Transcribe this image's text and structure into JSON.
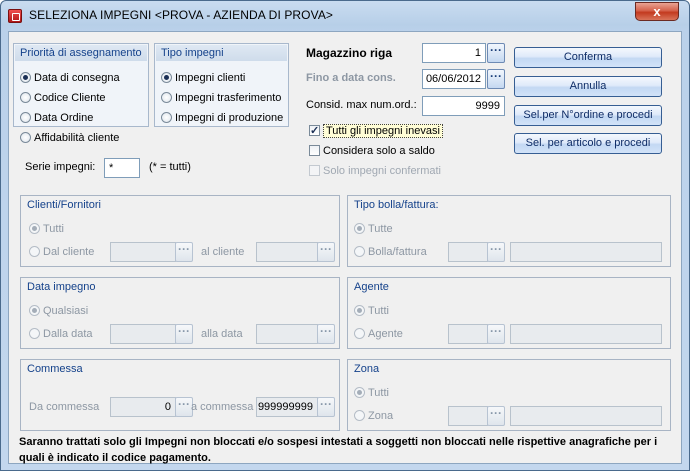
{
  "window": {
    "title": "SELEZIONA IMPEGNI <PROVA - AZIENDA DI PROVA>",
    "close_glyph": "x"
  },
  "priority": {
    "title": "Priorità di assegnamento",
    "options": [
      "Data di consegna",
      "Codice Cliente",
      "Data Ordine",
      "Affidabilità cliente"
    ],
    "selected": "Data di consegna"
  },
  "tipo_impegni": {
    "title": "Tipo impegni",
    "options": [
      "Impegni clienti",
      "Impegni trasferimento",
      "Impegni di produzione"
    ],
    "selected": "Impegni clienti"
  },
  "serie": {
    "label": "Serie impegni:",
    "value": "*",
    "hint": "(* = tutti)"
  },
  "magazzino": {
    "label": "Magazzino riga",
    "value": "1"
  },
  "fino_data": {
    "label": "Fino a data cons.",
    "value": "06/06/2012"
  },
  "consid": {
    "label": "Consid. max num.ord.:",
    "value": "9999"
  },
  "checks": {
    "tutti_inevasi": {
      "label": "Tutti gli impegni inevasi",
      "checked": true
    },
    "solo_saldo": {
      "label": "Considera solo a saldo",
      "checked": false
    },
    "solo_confermati": {
      "label": "Solo impegni confermati",
      "checked": false
    }
  },
  "buttons": {
    "conferma": "Conferma",
    "annulla": "Annulla",
    "sel_ordine": "Sel.per N°ordine e procedi",
    "sel_articolo": "Sel. per articolo e procedi"
  },
  "dots_glyph": "···",
  "clienti": {
    "title": "Clienti/Fornitori",
    "all_label": "Tutti",
    "from_label": "Dal cliente",
    "to_label": "al cliente"
  },
  "tipo_bolla": {
    "title": "Tipo bolla/fattura:",
    "all_label": "Tutte",
    "one_label": "Bolla/fattura"
  },
  "data_impegno": {
    "title": "Data impegno",
    "all_label": "Qualsiasi",
    "from_label": "Dalla data",
    "to_label": "alla data"
  },
  "agente": {
    "title": "Agente",
    "all_label": "Tutti",
    "one_label": "Agente"
  },
  "commessa": {
    "title": "Commessa",
    "from_label": "Da commessa",
    "from_value": "0",
    "to_label": "a commessa",
    "to_value": "999999999"
  },
  "zona": {
    "title": "Zona",
    "all_label": "Tutti",
    "one_label": "Zona"
  },
  "footer": "Saranno trattati solo gli Impegni non bloccati e/o sospesi intestati a soggetti non bloccati nelle rispettive anagrafiche per i quali è indicato il codice pagamento."
}
